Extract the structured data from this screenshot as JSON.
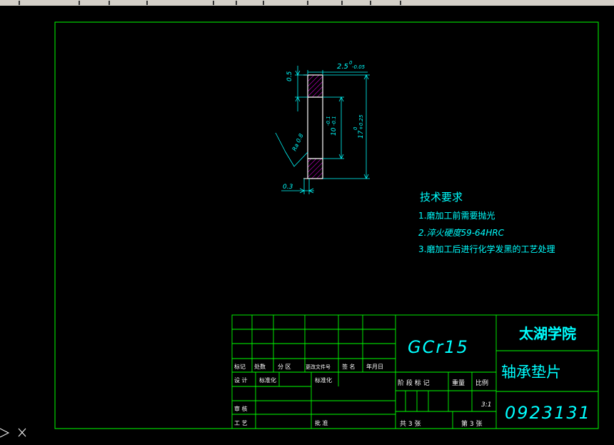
{
  "colors": {
    "frame": "#00ff00",
    "outline": "#ffffff",
    "dimension": "#00ffff",
    "hatch": "#cc00cc",
    "text": "#00ffff"
  },
  "drawing": {
    "dims": {
      "top_tolerance": "2.5",
      "top_tolerance_sup": "0",
      "top_tolerance_sub": "-0.05",
      "left_top": "0.5",
      "inner": "10",
      "inner_sup": "-0.1",
      "inner_sub": "-0.1",
      "outer": "17",
      "outer_sup": "0",
      "outer_sub": "+0.25",
      "roughness": "Ra 0.8",
      "bottom_width": "0.3"
    }
  },
  "tech": {
    "title": "技术要求",
    "items": [
      "1.磨加工前需要抛光",
      "2.淬火硬度59-64HRC",
      "3.磨加工后进行化学发黑的工艺处理"
    ]
  },
  "title_block": {
    "material": "GCr15",
    "school": "太湖学院",
    "part_name": "轴承垫片",
    "drawing_no": "0923131",
    "labels": {
      "mark": "标记",
      "count": "处数",
      "zone": "分 区",
      "change_doc": "更改文件号",
      "sign": "签 名",
      "date": "年月日",
      "design": "设 计",
      "standardize1": "标准化",
      "standardize2": "标准化",
      "stage": "阶 段 标 记",
      "weight": "重量",
      "scale_label": "比例",
      "review": "审 核",
      "process": "工 艺",
      "approve": "批 准"
    },
    "scale": "3:1",
    "sheets": "共 3 张",
    "sheet_no": "第 3 张"
  },
  "ucs_icon": "ucs-icon"
}
